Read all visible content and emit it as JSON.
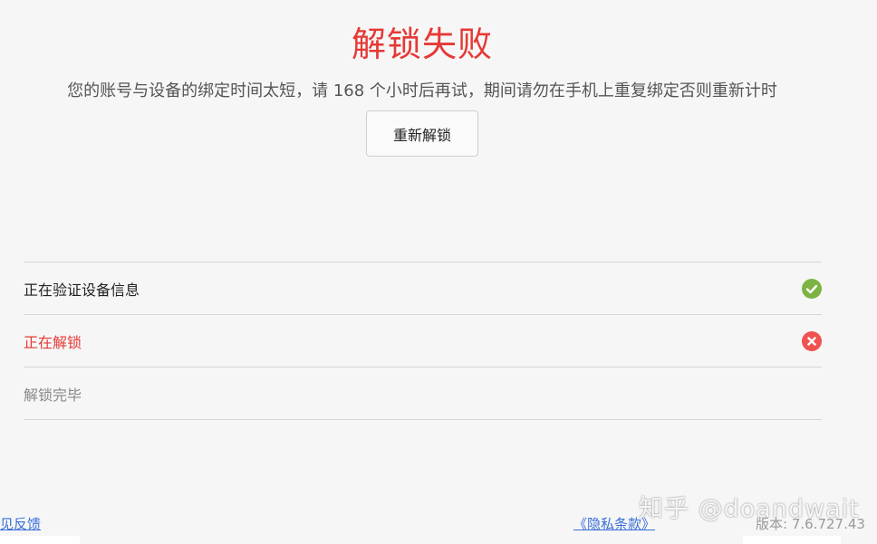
{
  "header": {
    "title": "解锁失败",
    "message": "您的账号与设备的绑定时间太短，请 168 个小时后再试，期间请勿在手机上重复绑定否则重新计时"
  },
  "actions": {
    "retry_label": "重新解锁"
  },
  "steps": [
    {
      "label": "正在验证设备信息",
      "status": "success",
      "icon": "check-circle-icon",
      "color": "#7cb342"
    },
    {
      "label": "正在解锁",
      "status": "error",
      "icon": "close-circle-icon",
      "color": "#ef5350"
    },
    {
      "label": "解锁完毕",
      "status": "pending"
    }
  ],
  "footer": {
    "feedback_label": "见反馈",
    "privacy_label": "《隐私条款》",
    "version_label": "版本: 7.6.727.43"
  },
  "watermark": "知乎 @doandwait",
  "colors": {
    "error": "#e53935",
    "success": "#7cb342",
    "link": "#3a6fd8",
    "background": "#f6f6f6"
  }
}
